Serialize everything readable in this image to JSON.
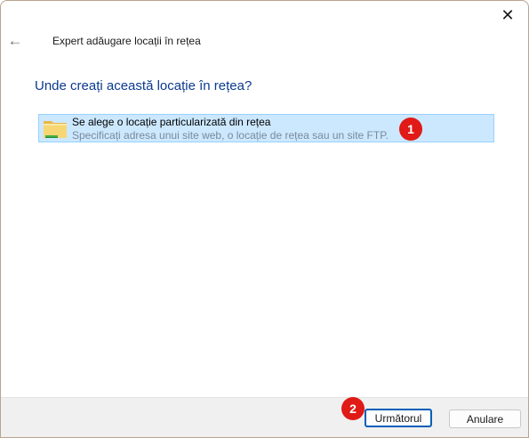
{
  "window": {
    "close_label": "✕",
    "back_label": "←",
    "title": "Expert adăugare locații în rețea"
  },
  "question": "Unde creați această locație în rețea?",
  "option": {
    "title": "Se alege o locație particularizată din rețea",
    "subtitle": "Specificați adresa unui site web, o locație de rețea sau un site FTP.",
    "icon": "folder-icon"
  },
  "badges": [
    "1",
    "2"
  ],
  "footer": {
    "next_label": "Următorul",
    "cancel_label": "Anulare"
  },
  "colors": {
    "accent": "#005fb8",
    "selection": "#cce8ff",
    "badge": "#e01a17",
    "heading": "#0b3a8f"
  }
}
